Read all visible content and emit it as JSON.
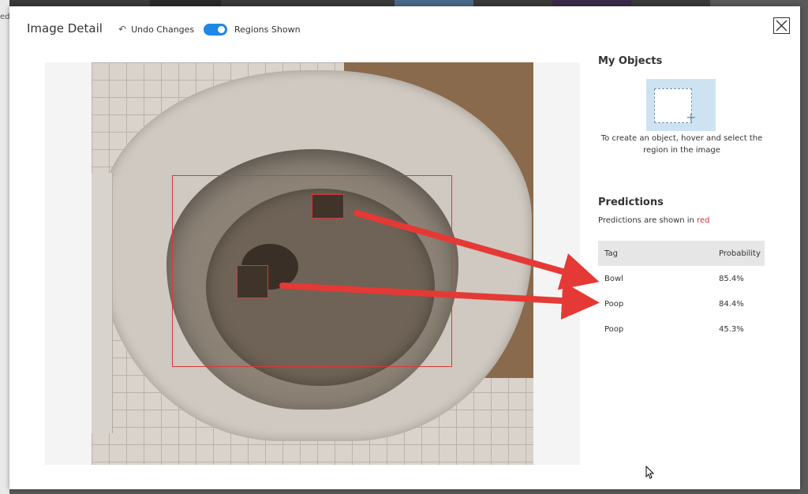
{
  "background": {
    "side_text": "ed"
  },
  "header": {
    "title": "Image Detail",
    "undo_label": "Undo Changes",
    "toggle_label": "Regions Shown",
    "toggle_on": true
  },
  "image": {
    "description_icon": "photo"
  },
  "my_objects": {
    "title": "My Objects",
    "hint": "To create an object, hover and select the region in the image"
  },
  "predictions": {
    "title": "Predictions",
    "note_prefix": "Predictions are shown in ",
    "note_color_word": "red",
    "columns": [
      "Tag",
      "Probability"
    ],
    "rows": [
      {
        "tag": "Bowl",
        "probability": "85.4%"
      },
      {
        "tag": "Poop",
        "probability": "84.4%"
      },
      {
        "tag": "Poop",
        "probability": "45.3%"
      }
    ]
  },
  "colors": {
    "accent": "#1e88e5",
    "prediction": "#d63a3a",
    "arrow": "#e53935"
  }
}
